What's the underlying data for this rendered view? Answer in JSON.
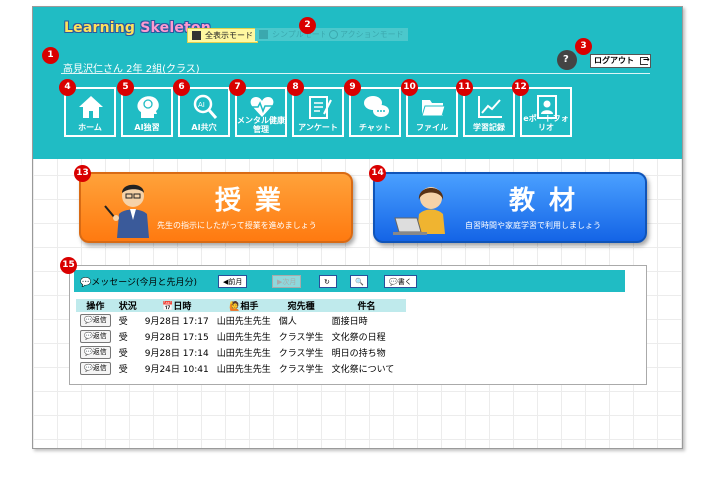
{
  "app": {
    "logo_part1": "Learning",
    "logo_part2": "Skeleton"
  },
  "modes": {
    "full": "全表示モード",
    "simple": "シンプルモード",
    "action": "アクションモード"
  },
  "user": {
    "line": "高見沢仁さん 2年 2組(クラス)"
  },
  "logout_label": "ログアウト",
  "nav": [
    {
      "label": "ホーム",
      "badge": "4"
    },
    {
      "label": "AI独習",
      "badge": "5"
    },
    {
      "label": "AI共穴",
      "badge": "6"
    },
    {
      "label": "メンタル健康管理",
      "badge": "7"
    },
    {
      "label": "アンケート",
      "badge": "8"
    },
    {
      "label": "チャット",
      "badge": "9"
    },
    {
      "label": "ファイル",
      "badge": "10"
    },
    {
      "label": "学習記録",
      "badge": "11"
    },
    {
      "label": "eポートフォリオ",
      "badge": "12"
    }
  ],
  "badges": {
    "user": "1",
    "mode": "2",
    "logout": "3",
    "lesson": "13",
    "material": "14",
    "messages": "15"
  },
  "lesson": {
    "title": "授業",
    "subtitle": "先生の指示にしたがって授業を進めましょう"
  },
  "material": {
    "title": "教材",
    "subtitle": "自習時間や家庭学習で利用しましょう"
  },
  "messages": {
    "title": "メッセージ(今月と先月分)",
    "buttons": {
      "prev": "前月",
      "next": "次月",
      "write": "書く"
    },
    "columns": [
      "操作",
      "状況",
      "日時",
      "相手",
      "宛先種",
      "件名"
    ],
    "reply_label": "返信",
    "rows": [
      {
        "status": "受",
        "datetime": "9月28日 17:17",
        "partner": "山田先生先生",
        "dest": "個人",
        "subject": "面接日時"
      },
      {
        "status": "受",
        "datetime": "9月28日 17:15",
        "partner": "山田先生先生",
        "dest": "クラス学生",
        "subject": "文化祭の日程"
      },
      {
        "status": "受",
        "datetime": "9月28日 17:14",
        "partner": "山田先生先生",
        "dest": "クラス学生",
        "subject": "明日の持ち物"
      },
      {
        "status": "受",
        "datetime": "9月24日 10:41",
        "partner": "山田先生先生",
        "dest": "クラス学生",
        "subject": "文化祭について"
      }
    ]
  }
}
